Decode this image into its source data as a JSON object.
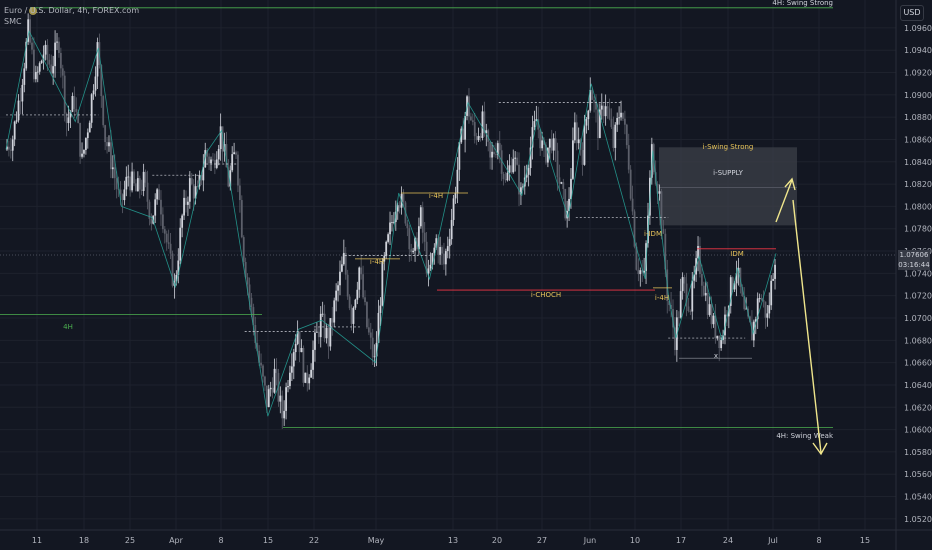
{
  "chart_data": {
    "type": "candlestick",
    "symbol_title": "Euro / U.S. Dollar, 4h, FOREX.com",
    "indicator": "SMC",
    "currency": "USD",
    "ylim": [
      1.051,
      1.0985
    ],
    "y_ticks": [
      "1.09600",
      "1.09400",
      "1.09200",
      "1.09000",
      "1.08800",
      "1.08600",
      "1.08400",
      "1.08200",
      "1.08000",
      "1.07800",
      "1.07600",
      "1.07400",
      "1.07200",
      "1.07000",
      "1.06800",
      "1.06600",
      "1.06400",
      "1.06200",
      "1.06000",
      "1.05800",
      "1.05600",
      "1.05400",
      "1.05200"
    ],
    "x_ticks": [
      "11",
      "18",
      "25",
      "Apr",
      "8",
      "15",
      "22",
      "May",
      "13",
      "20",
      "27",
      "Jun",
      "10",
      "17",
      "24",
      "Jul",
      "8",
      "15"
    ],
    "last_price": "1.07606",
    "countdown": "03:16:44",
    "price_path": [
      [
        0,
        1.0851
      ],
      [
        1,
        1.0862
      ],
      [
        2,
        1.0904
      ],
      [
        3,
        1.0957
      ],
      [
        4,
        1.0912
      ],
      [
        5,
        1.0938
      ],
      [
        6,
        1.0925
      ],
      [
        7,
        1.0948
      ],
      [
        8,
        1.0876
      ],
      [
        9,
        1.0895
      ],
      [
        10,
        1.084
      ],
      [
        11,
        1.0883
      ],
      [
        12,
        1.0942
      ],
      [
        13,
        1.0862
      ],
      [
        14,
        1.0835
      ],
      [
        15,
        1.08
      ],
      [
        16,
        1.0828
      ],
      [
        17,
        1.0813
      ],
      [
        18,
        1.0822
      ],
      [
        19,
        1.079
      ],
      [
        20,
        1.0812
      ],
      [
        21,
        1.0768
      ],
      [
        22,
        1.0728
      ],
      [
        23,
        1.079
      ],
      [
        24,
        1.082
      ],
      [
        25,
        1.081
      ],
      [
        26,
        1.0848
      ],
      [
        27,
        1.0838
      ],
      [
        28,
        1.0868
      ],
      [
        29,
        1.0822
      ],
      [
        30,
        1.0852
      ],
      [
        31,
        1.0758
      ],
      [
        32,
        1.0706
      ],
      [
        33,
        1.066
      ],
      [
        34,
        1.0625
      ],
      [
        35,
        1.065
      ],
      [
        36,
        1.0612
      ],
      [
        37,
        1.066
      ],
      [
        38,
        1.069
      ],
      [
        39,
        1.064
      ],
      [
        40,
        1.067
      ],
      [
        41,
        1.0698
      ],
      [
        42,
        1.068
      ],
      [
        43,
        1.072
      ],
      [
        44,
        1.0752
      ],
      [
        45,
        1.0702
      ],
      [
        46,
        1.0745
      ],
      [
        47,
        1.0692
      ],
      [
        48,
        1.066
      ],
      [
        49,
        1.074
      ],
      [
        50,
        1.0778
      ],
      [
        51,
        1.0812
      ],
      [
        52,
        1.0793
      ],
      [
        53,
        1.0752
      ],
      [
        54,
        1.079
      ],
      [
        55,
        1.0735
      ],
      [
        56,
        1.077
      ],
      [
        57,
        1.0748
      ],
      [
        58,
        1.079
      ],
      [
        59,
        1.0848
      ],
      [
        60,
        1.0893
      ],
      [
        61,
        1.0862
      ],
      [
        62,
        1.0875
      ],
      [
        63,
        1.084
      ],
      [
        64,
        1.086
      ],
      [
        65,
        1.082
      ],
      [
        66,
        1.0848
      ],
      [
        67,
        1.081
      ],
      [
        68,
        1.0845
      ],
      [
        69,
        1.0878
      ],
      [
        70,
        1.0845
      ],
      [
        71,
        1.086
      ],
      [
        72,
        1.0822
      ],
      [
        73,
        1.079
      ],
      [
        74,
        1.087
      ],
      [
        75,
        1.0848
      ],
      [
        76,
        1.091
      ],
      [
        77,
        1.087
      ],
      [
        78,
        1.0895
      ],
      [
        79,
        1.0855
      ],
      [
        80,
        1.0892
      ],
      [
        81,
        1.084
      ],
      [
        82,
        1.075
      ],
      [
        83,
        1.0735
      ],
      [
        84,
        1.085
      ],
      [
        85,
        1.081
      ],
      [
        86,
        1.0722
      ],
      [
        87,
        1.0682
      ],
      [
        88,
        1.073
      ],
      [
        89,
        1.0712
      ],
      [
        90,
        1.0755
      ],
      [
        91,
        1.072
      ],
      [
        92,
        1.0693
      ],
      [
        93,
        1.068
      ],
      [
        94,
        1.072
      ],
      [
        95,
        1.0745
      ],
      [
        96,
        1.0702
      ],
      [
        97,
        1.0686
      ],
      [
        98,
        1.0722
      ],
      [
        99,
        1.07
      ],
      [
        100,
        1.0758
      ]
    ],
    "annotations": {
      "swing_strong_4h": {
        "label": "4H: Swing Strong",
        "price": 1.0978
      },
      "swing_weak_4h": {
        "label": "4H: Swing Weak",
        "price": 1.0602
      },
      "level_4h": {
        "label": "4H",
        "price": 1.0703
      },
      "i_swing_strong": {
        "label": "i-Swing Strong",
        "price": 1.0853
      },
      "i_supply": {
        "label": "i-SUPPLY",
        "top": 1.0853,
        "bottom": 1.0783
      },
      "i_choch": {
        "label": "i-CHOCH",
        "price": 1.0725
      },
      "idm_right": {
        "label": "IDM",
        "price": 1.0762
      },
      "idm_left": {
        "label": "i-IDM",
        "price": 1.0778
      },
      "i4h_labels": [
        "i-4H",
        "i-4H",
        "i-4H",
        "i-4H"
      ],
      "x_marker": "x"
    }
  }
}
